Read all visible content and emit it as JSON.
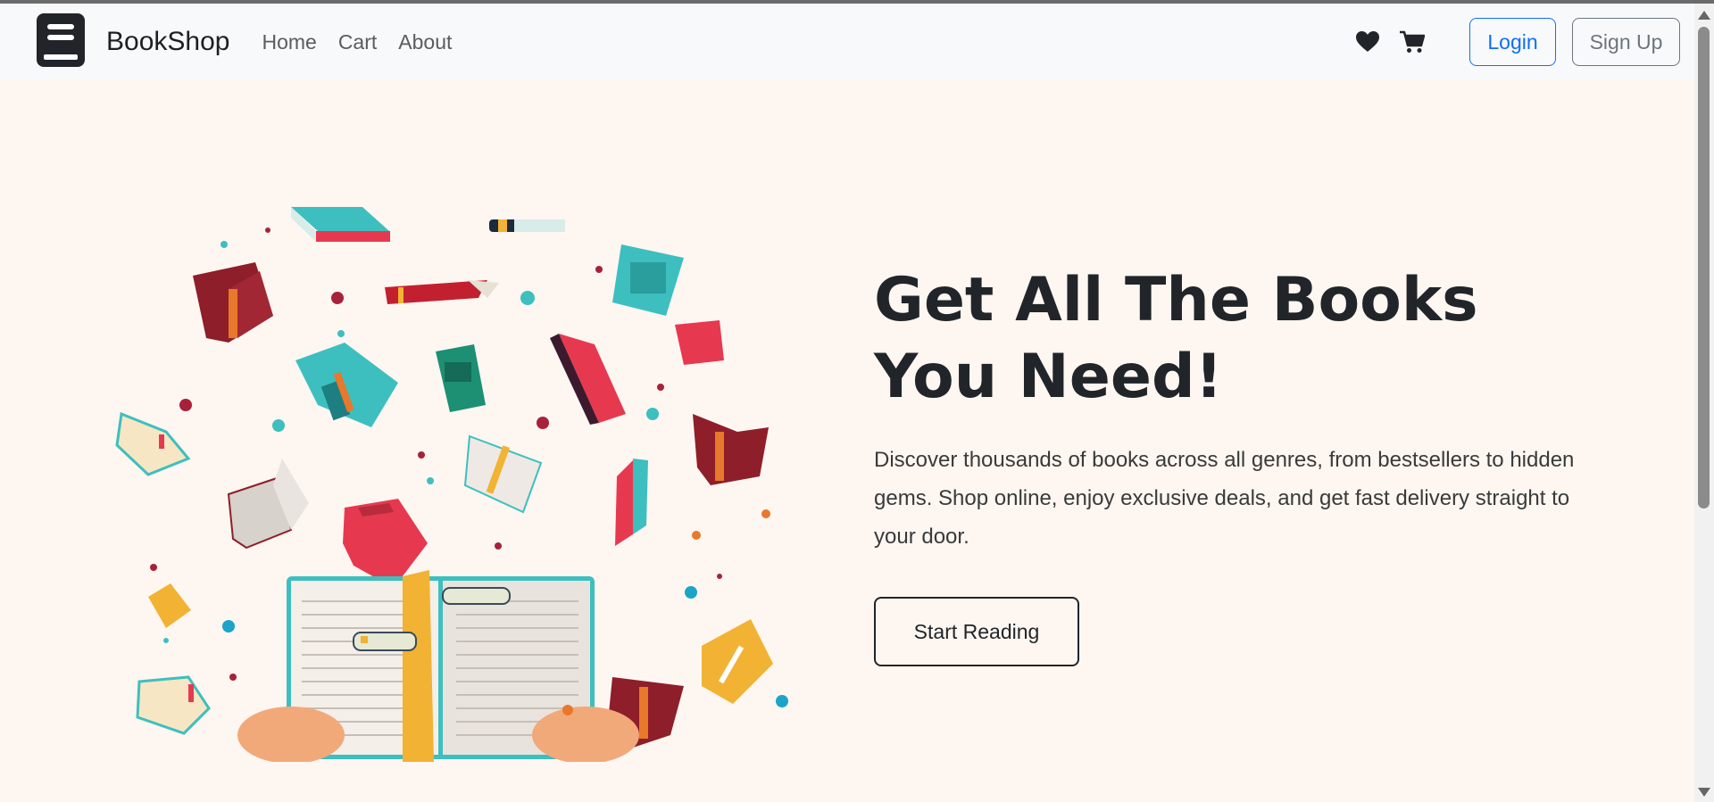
{
  "navbar": {
    "brand": {
      "title": "BookShop",
      "icon": "book-icon"
    },
    "links": [
      {
        "label": "Home"
      },
      {
        "label": "Cart"
      },
      {
        "label": "About"
      }
    ],
    "icons": [
      "heart-icon",
      "cart-icon"
    ],
    "login_label": "Login",
    "signup_label": "Sign Up"
  },
  "hero": {
    "headline": "Get All The Books You Need!",
    "description": "Discover thousands of books across all genres, from bestsellers to hidden gems. Shop online, enjoy exclusive deals, and get fast delivery straight to your door.",
    "cta_label": "Start Reading",
    "illustration": "flying-books-illustration"
  },
  "colors": {
    "page_bg": "#fef6f1",
    "navbar_bg": "#f8f9fa",
    "primary": "#0d6efd",
    "secondary": "#6c757d",
    "text_dark": "#212529",
    "book_red": "#e63950",
    "book_teal": "#3dbfbf",
    "book_maroon": "#8e1e2a",
    "book_yellow": "#f2b233"
  }
}
